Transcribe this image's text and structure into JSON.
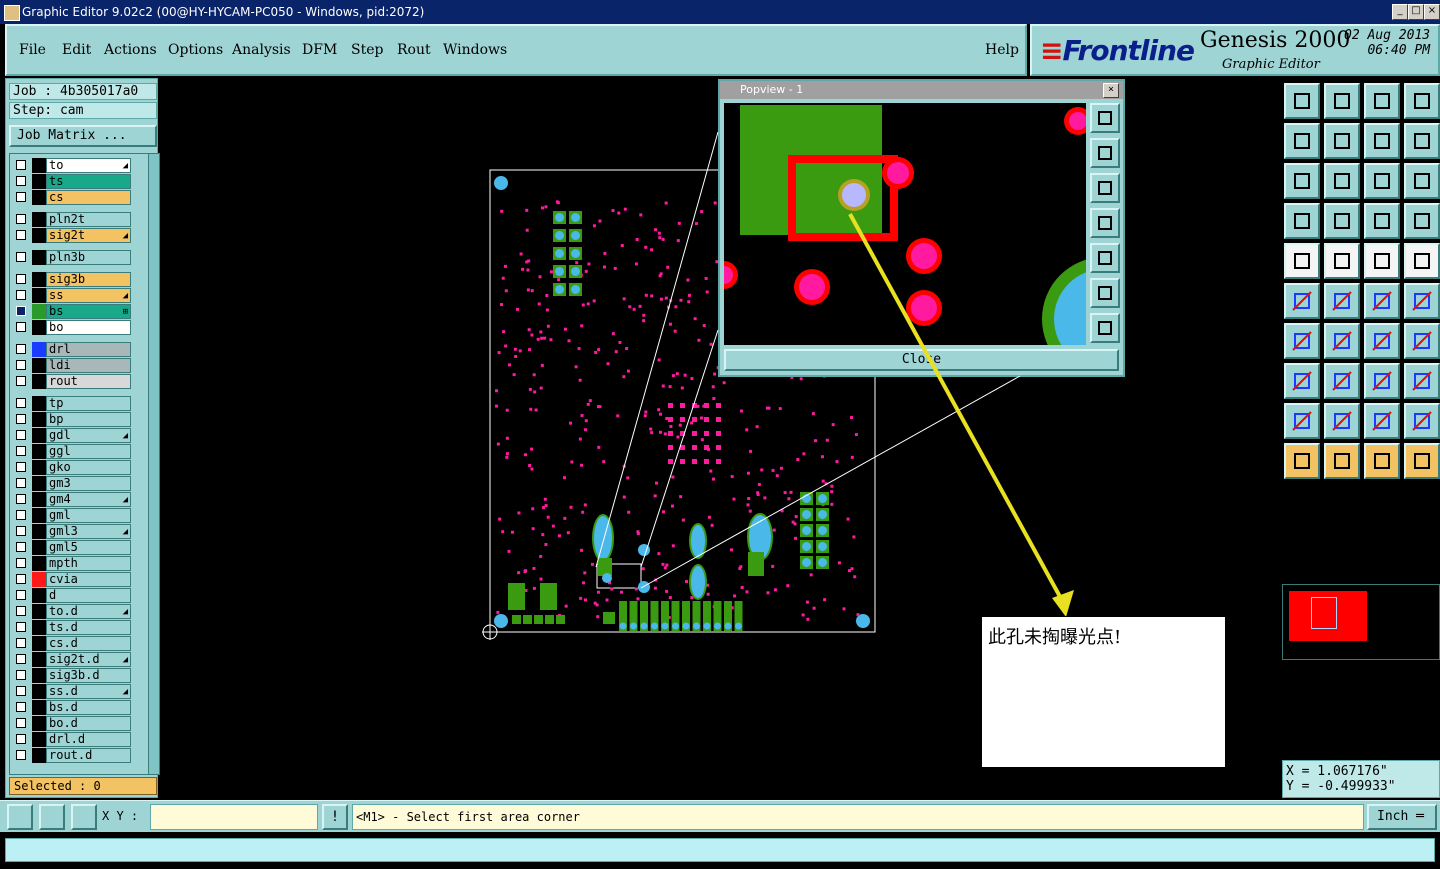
{
  "window": {
    "title": "Graphic Editor 9.02c2 (00@HY-HYCAM-PC050 - Windows, pid:2072)"
  },
  "menu": {
    "items": [
      "File",
      "Edit",
      "Actions",
      "Options",
      "Analysis",
      "DFM",
      "Step",
      "Rout",
      "Windows"
    ],
    "help": "Help"
  },
  "brand": {
    "logo": "Frontline",
    "product": "Genesis 2000",
    "subtitle": "Graphic Editor",
    "date": "02 Aug 2013",
    "time": "06:40 PM"
  },
  "left": {
    "job": "Job : 4b305017a0",
    "step": "Step: cam",
    "job_matrix_label": "Job Matrix ...",
    "selected": "Selected : 0",
    "layers": [
      {
        "name": "to",
        "color": "#ffffff",
        "sw": "#000000",
        "mark": "◢"
      },
      {
        "name": "ts",
        "color": "#1aa88a",
        "sw": "#000000",
        "mark": ""
      },
      {
        "name": "cs",
        "color": "#f3c263",
        "sw": "#000000",
        "mark": ""
      },
      {
        "name": "pln2t",
        "color": "#9fd4d4",
        "sw": "#000000",
        "mark": ""
      },
      {
        "name": "sig2t",
        "color": "#f3c263",
        "sw": "#000000",
        "mark": "◢"
      },
      {
        "name": "pln3b",
        "color": "#9fd4d4",
        "sw": "#000000",
        "mark": ""
      },
      {
        "name": "sig3b",
        "color": "#f3c263",
        "sw": "#000000",
        "mark": ""
      },
      {
        "name": "ss",
        "color": "#f3c263",
        "sw": "#000000",
        "mark": "◢"
      },
      {
        "name": "bs",
        "color": "#1aa88a",
        "sw": "#2a9a2a",
        "mark": "⊞"
      },
      {
        "name": "bo",
        "color": "#ffffff",
        "sw": "#000000",
        "mark": ""
      },
      {
        "name": "drl",
        "color": "#a8b8b8",
        "sw": "#1a3cff",
        "mark": ""
      },
      {
        "name": "ldi",
        "color": "#a8b8b8",
        "sw": "#000000",
        "mark": ""
      },
      {
        "name": "rout",
        "color": "#d8d8d8",
        "sw": "#000000",
        "mark": ""
      },
      {
        "name": "tp",
        "color": "#9fd4d4",
        "sw": "#000000",
        "mark": ""
      },
      {
        "name": "bp",
        "color": "#9fd4d4",
        "sw": "#000000",
        "mark": ""
      },
      {
        "name": "gdl",
        "color": "#9fd4d4",
        "sw": "#000000",
        "mark": "◢"
      },
      {
        "name": "ggl",
        "color": "#9fd4d4",
        "sw": "#000000",
        "mark": ""
      },
      {
        "name": "gko",
        "color": "#9fd4d4",
        "sw": "#000000",
        "mark": ""
      },
      {
        "name": "gm3",
        "color": "#9fd4d4",
        "sw": "#000000",
        "mark": ""
      },
      {
        "name": "gm4",
        "color": "#9fd4d4",
        "sw": "#000000",
        "mark": "◢"
      },
      {
        "name": "gml",
        "color": "#9fd4d4",
        "sw": "#000000",
        "mark": ""
      },
      {
        "name": "gml3",
        "color": "#9fd4d4",
        "sw": "#000000",
        "mark": "◢"
      },
      {
        "name": "gml5",
        "color": "#9fd4d4",
        "sw": "#000000",
        "mark": ""
      },
      {
        "name": "mpth",
        "color": "#9fd4d4",
        "sw": "#000000",
        "mark": ""
      },
      {
        "name": "cvia",
        "color": "#9fd4d4",
        "sw": "#ff1a1a",
        "mark": ""
      },
      {
        "name": "d",
        "color": "#9fd4d4",
        "sw": "#000000",
        "mark": ""
      },
      {
        "name": "to.d",
        "color": "#9fd4d4",
        "sw": "#000000",
        "mark": "◢"
      },
      {
        "name": "ts.d",
        "color": "#9fd4d4",
        "sw": "#000000",
        "mark": ""
      },
      {
        "name": "cs.d",
        "color": "#9fd4d4",
        "sw": "#000000",
        "mark": ""
      },
      {
        "name": "sig2t.d",
        "color": "#9fd4d4",
        "sw": "#000000",
        "mark": "◢"
      },
      {
        "name": "sig3b.d",
        "color": "#9fd4d4",
        "sw": "#000000",
        "mark": ""
      },
      {
        "name": "ss.d",
        "color": "#9fd4d4",
        "sw": "#000000",
        "mark": "◢"
      },
      {
        "name": "bs.d",
        "color": "#9fd4d4",
        "sw": "#000000",
        "mark": ""
      },
      {
        "name": "bo.d",
        "color": "#9fd4d4",
        "sw": "#000000",
        "mark": ""
      },
      {
        "name": "drl.d",
        "color": "#9fd4d4",
        "sw": "#000000",
        "mark": ""
      },
      {
        "name": "rout.d",
        "color": "#9fd4d4",
        "sw": "#000000",
        "mark": ""
      }
    ]
  },
  "popview": {
    "title": "Popview - 1",
    "close_label": "Close"
  },
  "note": {
    "text": "此孔未掏曝光点!"
  },
  "coords": {
    "x": "X = 1.067176\"",
    "y": "Y = -0.499933\""
  },
  "bottom": {
    "xy_label": "X Y :",
    "xy_value": "",
    "prompt": "<M1> - Select first area corner",
    "units": "Inch"
  },
  "colors": {
    "panel": "#9fd4d4",
    "accent_orange": "#f3c263",
    "pad_green": "#3a9a10",
    "pad_cyan": "#4ab8e8",
    "via_magenta": "#ff1aa0",
    "highlight_red": "#ff0000",
    "arrow_yellow": "#e8e020"
  }
}
